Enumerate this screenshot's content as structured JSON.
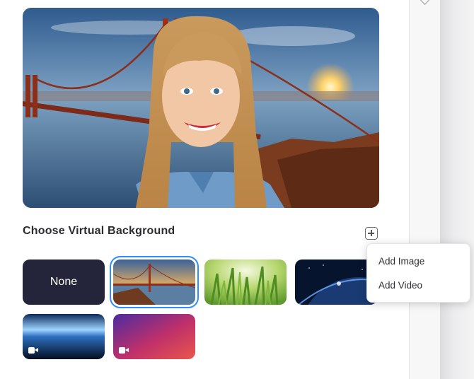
{
  "section": {
    "title": "Choose Virtual Background"
  },
  "add_button": {
    "icon": "plus-icon"
  },
  "backgrounds": [
    {
      "label": "None",
      "selected": false,
      "is_video": false
    },
    {
      "label": "Golden Gate Bridge",
      "selected": true,
      "is_video": false
    },
    {
      "label": "Grass",
      "selected": false,
      "is_video": false
    },
    {
      "label": "Earth from space",
      "selected": false,
      "is_video": false
    },
    {
      "label": "Earth horizon",
      "selected": false,
      "is_video": true
    },
    {
      "label": "Purple gradient",
      "selected": false,
      "is_video": true
    }
  ],
  "menu": {
    "items": [
      "Add Image",
      "Add Video"
    ]
  },
  "colors": {
    "accent": "#2d8cff",
    "none_tile": "#24253a",
    "text": "#2b2b30"
  }
}
